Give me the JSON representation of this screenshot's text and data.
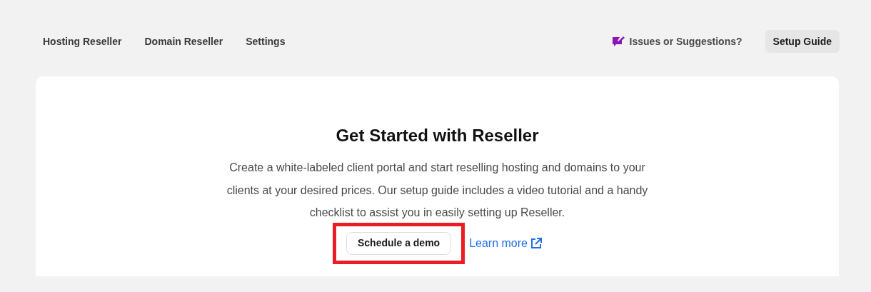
{
  "nav": {
    "links": [
      "Hosting Reseller",
      "Domain Reseller",
      "Settings"
    ],
    "feedback": "Issues or Suggestions?",
    "guide_button": "Setup Guide"
  },
  "card": {
    "title": "Get Started with Reseller",
    "description": "Create a white-labeled client portal and start reselling hosting and domains to your clients at your desired prices. Our setup guide includes a video tutorial and a handy checklist to assist you in easily setting up Reseller.",
    "demo_button": {
      "label": "Schedule a demo",
      "highlighted": true
    },
    "learn_more": "Learn more"
  }
}
